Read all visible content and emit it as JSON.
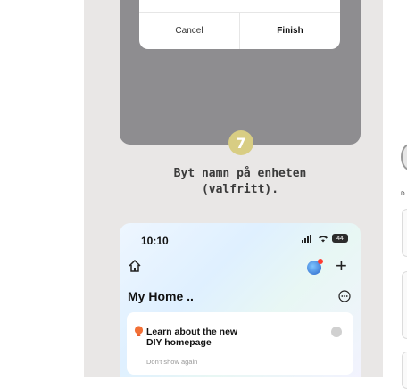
{
  "dialog": {
    "cancel_label": "Cancel",
    "finish_label": "Finish"
  },
  "step": {
    "number": "7",
    "caption_line1": "Byt namn på enheten",
    "caption_line2": "(valfritt)."
  },
  "phone": {
    "time": "10:10",
    "battery": "44",
    "home_title": "My Home ..",
    "card": {
      "title_line1": "Learn about the new",
      "title_line2": "DIY homepage",
      "subtitle": "Don't show again"
    }
  },
  "right_partial": {
    "letter": "D"
  },
  "colors": {
    "panel_bg": "#e9e7e6",
    "dark_card": "#8e8d90",
    "step_badge": "#d8cd83"
  },
  "icons": [
    "home-icon",
    "plus-icon",
    "more-icon",
    "bulb-icon",
    "chevron-icon",
    "signal-icon",
    "wifi-icon",
    "battery-icon"
  ]
}
